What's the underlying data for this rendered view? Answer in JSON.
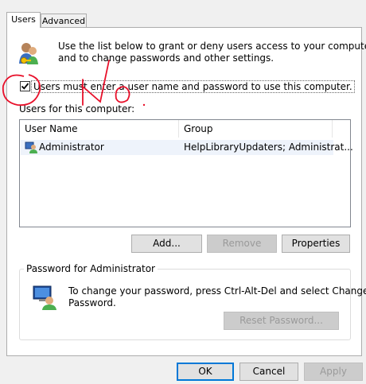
{
  "tabs": [
    {
      "label": "Users",
      "active": true
    },
    {
      "label": "Advanced",
      "active": false
    }
  ],
  "intro": {
    "line1": "Use the list below to grant or deny users access to your computer,",
    "line2": "and to change passwords and other settings."
  },
  "require_login": {
    "checked": true,
    "label": "Users must enter a user name and password to use this computer."
  },
  "users_list": {
    "title": "Users for this computer:",
    "columns": [
      "User Name",
      "Group"
    ],
    "rows": [
      {
        "user_name": "Administrator",
        "group": "HelpLibraryUpdaters; Administrat..."
      }
    ]
  },
  "list_buttons": {
    "add": "Add...",
    "remove": "Remove",
    "properties": "Properties"
  },
  "password_group": {
    "title": "Password for Administrator",
    "line1": "To change your password, press Ctrl-Alt-Del and select Change",
    "line2": "Password.",
    "reset_button": "Reset Password..."
  },
  "dialog_buttons": {
    "ok": "OK",
    "cancel": "Cancel",
    "apply": "Apply"
  },
  "annotation": {
    "text": "No",
    "color": "#e8102a"
  },
  "colors": {
    "panel": "#ffffff",
    "window": "#f0f0f0",
    "selection": "#eef3fb",
    "accent": "#0078d7"
  }
}
